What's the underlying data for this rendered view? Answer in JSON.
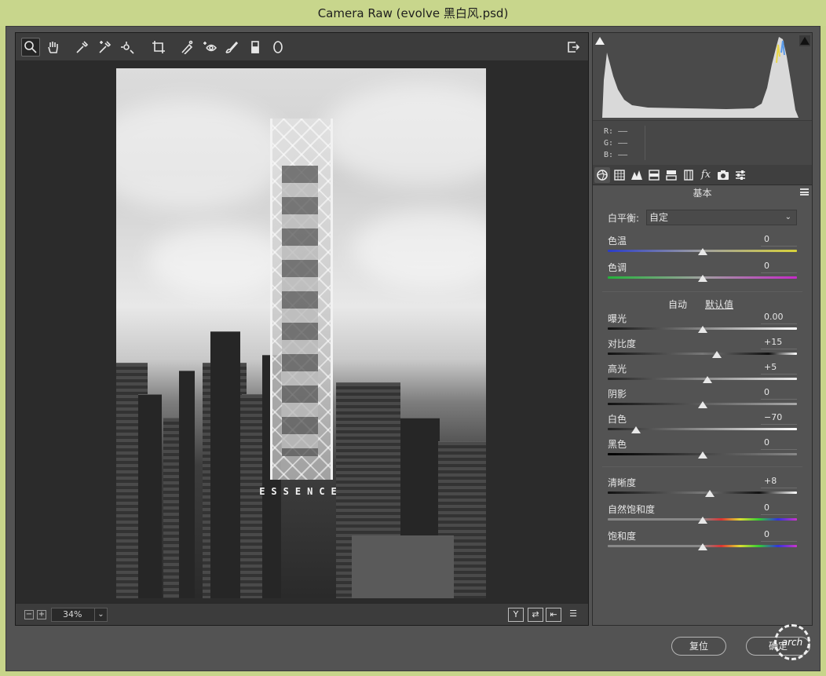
{
  "window": {
    "title": "Camera Raw (evolve 黑白风.psd)"
  },
  "toolbar": {
    "tools": [
      "zoom-icon",
      "hand-icon",
      "white-balance-icon",
      "color-sampler-icon",
      "targeted-adjust-icon",
      "crop-icon",
      "spot-removal-icon",
      "red-eye-icon",
      "adjustment-brush-icon",
      "graduated-filter-icon",
      "radial-filter-icon"
    ],
    "active_tool": "zoom-icon"
  },
  "photo": {
    "overlay_text": "ESSENCE"
  },
  "statusbar": {
    "zoom": "34%",
    "compare_label": "Y"
  },
  "histogram": {
    "r_label": "R:",
    "g_label": "G:",
    "b_label": "B:",
    "r_value": "——",
    "g_value": "——",
    "b_value": "——"
  },
  "panel": {
    "title": "基本",
    "white_balance_label": "白平衡:",
    "white_balance_value": "自定",
    "auto_label": "自动",
    "default_label": "默认值",
    "sliders": [
      {
        "label": "色温",
        "value": "0",
        "position": 0.5
      },
      {
        "label": "色调",
        "value": "0",
        "position": 0.5
      },
      {
        "label": "曝光",
        "value": "0.00",
        "position": 0.5
      },
      {
        "label": "对比度",
        "value": "+15",
        "position": 0.575
      },
      {
        "label": "高光",
        "value": "+5",
        "position": 0.525
      },
      {
        "label": "阴影",
        "value": "0",
        "position": 0.5
      },
      {
        "label": "白色",
        "value": "−70",
        "position": 0.15
      },
      {
        "label": "黑色",
        "value": "0",
        "position": 0.5
      },
      {
        "label": "清晰度",
        "value": "+8",
        "position": 0.54
      },
      {
        "label": "自然饱和度",
        "value": "0",
        "position": 0.5
      },
      {
        "label": "饱和度",
        "value": "0",
        "position": 0.5
      }
    ]
  },
  "buttons": {
    "reset": "复位",
    "ok": "确定"
  },
  "watermark": {
    "text": "arch"
  }
}
